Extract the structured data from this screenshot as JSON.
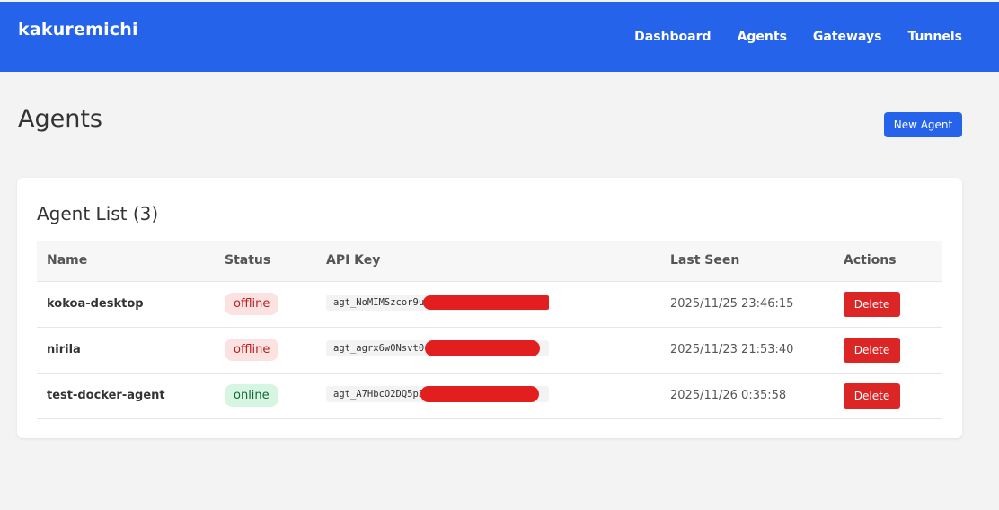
{
  "header": {
    "brand": "kakuremichi",
    "nav": [
      "Dashboard",
      "Agents",
      "Gateways",
      "Tunnels"
    ]
  },
  "page": {
    "title": "Agents",
    "new_button": "New Agent"
  },
  "card": {
    "title": "Agent List (3)",
    "columns": [
      "Name",
      "Status",
      "API Key",
      "Last Seen",
      "Actions"
    ],
    "rows": [
      {
        "name": "kokoa-desktop",
        "status": "offline",
        "api_key": "agt_NoMIMSzcor9u",
        "last_seen": "2025/11/25 23:46:15",
        "action": "Delete"
      },
      {
        "name": "nirila",
        "status": "offline",
        "api_key": "agt_agrx6w0Nsvt0",
        "last_seen": "2025/11/23 21:53:40",
        "action": "Delete"
      },
      {
        "name": "test-docker-agent",
        "status": "online",
        "api_key": "agt_A7HbcO2DQ5p3",
        "last_seen": "2025/11/26 0:35:58",
        "action": "Delete"
      }
    ]
  },
  "colors": {
    "primary": "#2563eb",
    "danger": "#dc2626",
    "offline_bg": "#fde2e2",
    "online_bg": "#d6f5e3",
    "redaction": "#e21e1e"
  }
}
